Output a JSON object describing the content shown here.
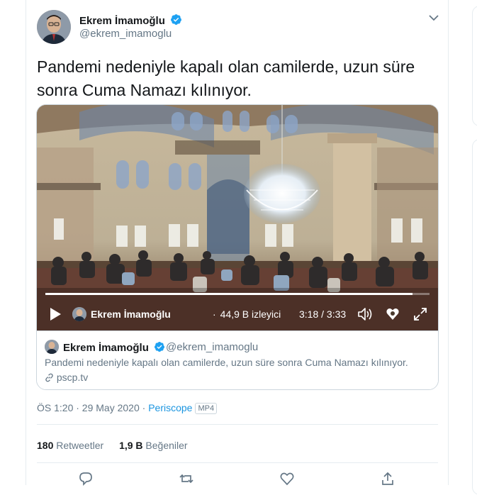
{
  "author": {
    "name": "Ekrem İmamoğlu",
    "handle": "@ekrem_imamoglu"
  },
  "tweet": {
    "text": "Pandemi nedeniyle kapalı olan camilerde, uzun süre sonra Cuma Namazı kılınıyor."
  },
  "video": {
    "progress_fraction": 0.955,
    "broadcaster": "Ekrem İmamoğlu",
    "viewers": "44,9 B izleyici",
    "time": "3:18 / 3:33"
  },
  "card": {
    "name": "Ekrem İmamoğlu",
    "handle": "@ekrem_imamoglu",
    "text": "Pandemi nedeniyle kapalı olan camilerde, uzun süre sonra Cuma Namazı kılınıyor.",
    "link": "pscp.tv"
  },
  "meta": {
    "time": "ÖS 1:20 · 29 May 2020 · ",
    "source": "Periscope",
    "badge": "MP4"
  },
  "stats": {
    "retweets_count": "180",
    "retweets_label": "Retweetler",
    "likes_count": "1,9 B",
    "likes_label": "Beğeniler"
  },
  "colors": {
    "link_blue": "#1b95e0",
    "secondary_text": "#657786",
    "border": "#e6ecf0",
    "verified": "#1da1f2"
  },
  "icons": [
    "verified-icon",
    "chevron-down-icon",
    "play-icon",
    "volume-icon",
    "heart-icon",
    "fullscreen-icon",
    "link-icon",
    "reply-icon",
    "retweet-icon",
    "like-icon",
    "share-icon"
  ]
}
